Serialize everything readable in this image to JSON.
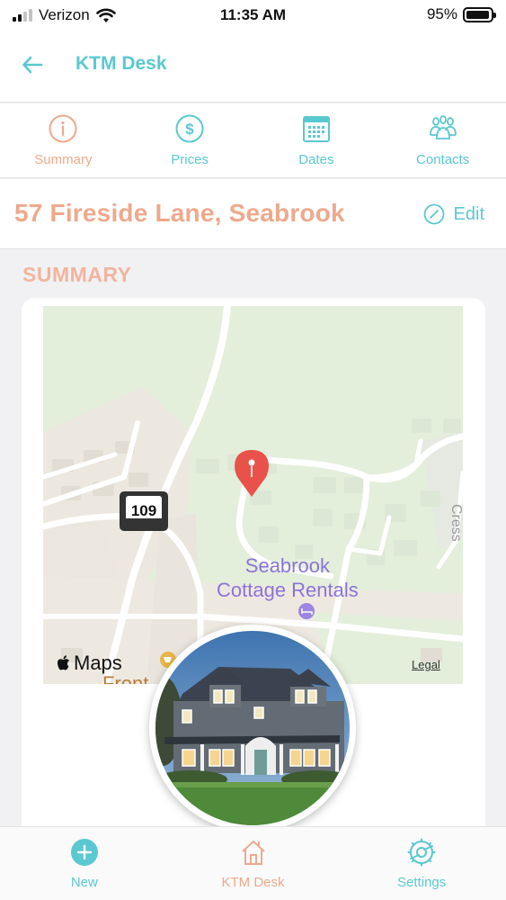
{
  "status_bar": {
    "carrier": "Verizon",
    "time": "11:35 AM",
    "battery": "95%",
    "battery_level": 0.95,
    "signal_bars": 2
  },
  "nav": {
    "back_icon": "arrow-left-icon",
    "title": "KTM Desk"
  },
  "tabs": [
    {
      "label": "Summary",
      "icon": "info-circle-icon",
      "active": true
    },
    {
      "label": "Prices",
      "icon": "dollar-circle-icon",
      "active": false
    },
    {
      "label": "Dates",
      "icon": "calendar-icon",
      "active": false
    },
    {
      "label": "Contacts",
      "icon": "people-icon",
      "active": false
    }
  ],
  "header": {
    "address": "57 Fireside Lane, Seabrook",
    "edit_label": "Edit"
  },
  "section": {
    "title": "SUMMARY"
  },
  "map": {
    "route_number": "109",
    "poi_line1": "Seabrook",
    "poi_line2": "Cottage Rentals",
    "street_fragment": "Cress",
    "bottom_fragment": "Front",
    "brand": "Maps",
    "legal": "Legal"
  },
  "bottom_nav": [
    {
      "label": "New",
      "icon": "plus-circle-icon",
      "active": false
    },
    {
      "label": "KTM Desk",
      "icon": "house-icon",
      "active": true
    },
    {
      "label": "Settings",
      "icon": "gear-icon",
      "active": false
    }
  ],
  "colors": {
    "accent_teal": "#5ac8d0",
    "accent_peach": "#eea98c",
    "poi_purple": "#8b74d6",
    "pin_red": "#e8524a"
  }
}
